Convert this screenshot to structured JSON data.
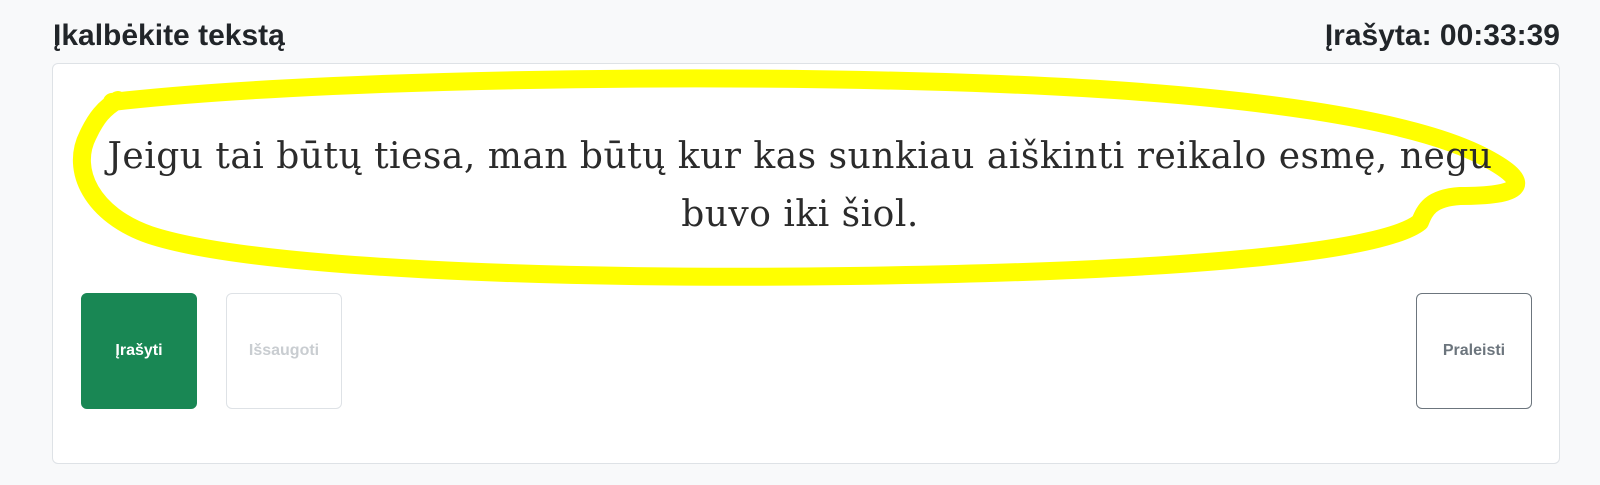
{
  "header": {
    "title": "Įkalbėkite tekstą",
    "status": "Įrašyta: 00:33:39"
  },
  "prompt": {
    "text": "Jeigu tai būtų tiesa, man būtų kur kas sunkiau aiškinti reikalo esmę, negu buvo iki šiol."
  },
  "buttons": {
    "record_label": "Įrašyti",
    "save_label": "Išsaugoti",
    "skip_label": "Praleisti"
  },
  "colors": {
    "record": "#198754",
    "highlight": "#ffff00",
    "background": "#f8f9fa"
  }
}
